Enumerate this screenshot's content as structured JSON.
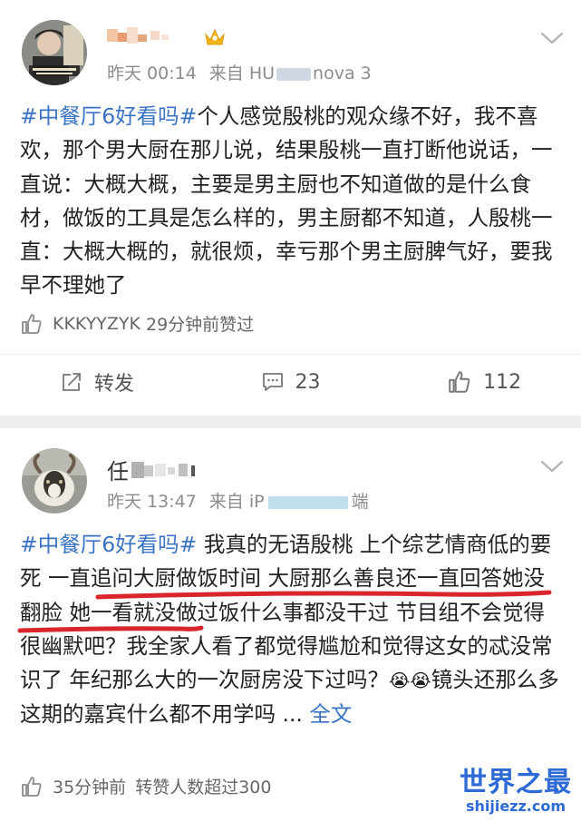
{
  "post1": {
    "username_visible": "",
    "time": "昨天 00:14",
    "source_prefix": "来自 HU",
    "source_suffix": "nova 3",
    "content_tag": "#中餐厅6好看吗#",
    "content_text": "个人感觉殷桃的观众缘不好，我不喜欢，那个男大厨在那儿说，结果殷桃一直打断他说话，一直说：大概大概，主要是男主厨也不知道做的是什么食材，做饭的工具是怎么样的，男主厨都不知道，人殷桃一直：大概大概的，就很烦，幸亏那个男主厨脾气好，要我早不理她了",
    "like_user": "KKKYYZYK",
    "like_time": "29分钟前赞过",
    "actions": {
      "repost_label": "转发",
      "comment_count": "23",
      "like_count": "112"
    }
  },
  "post2": {
    "username_visible": "任",
    "time": "昨天 13:47",
    "source_prefix": "来自 iP",
    "source_suffix": "端",
    "content_tag": "#中餐厅6好看吗#",
    "content_a": " 我真的无语殷桃 上个综艺情商低的要死 ",
    "content_highlight": "一直追问大厨做饭时间 大厨那么善良还一直回答她没翻脸",
    "content_b": " 她一看就没做过饭什么事都没干过 节目组不会觉得很幽默吧？我全家人看了都觉得尴尬和觉得这女的忒没常识了 年纪那么大的一次厨房没下过吗？",
    "content_emoji": "😭😭",
    "content_c": "镜头还那么多 这期的嘉宾什么都不用学吗 ... ",
    "full_text_link": "全文",
    "like_time": "35分钟前",
    "like_text": "转赞人数超过300"
  },
  "watermark": {
    "title": "世界之最",
    "sub": "shijiezz.com"
  },
  "colors": {
    "tag": "#3a73c4",
    "underline": "#d8262c",
    "meta": "#8c8c8c"
  }
}
